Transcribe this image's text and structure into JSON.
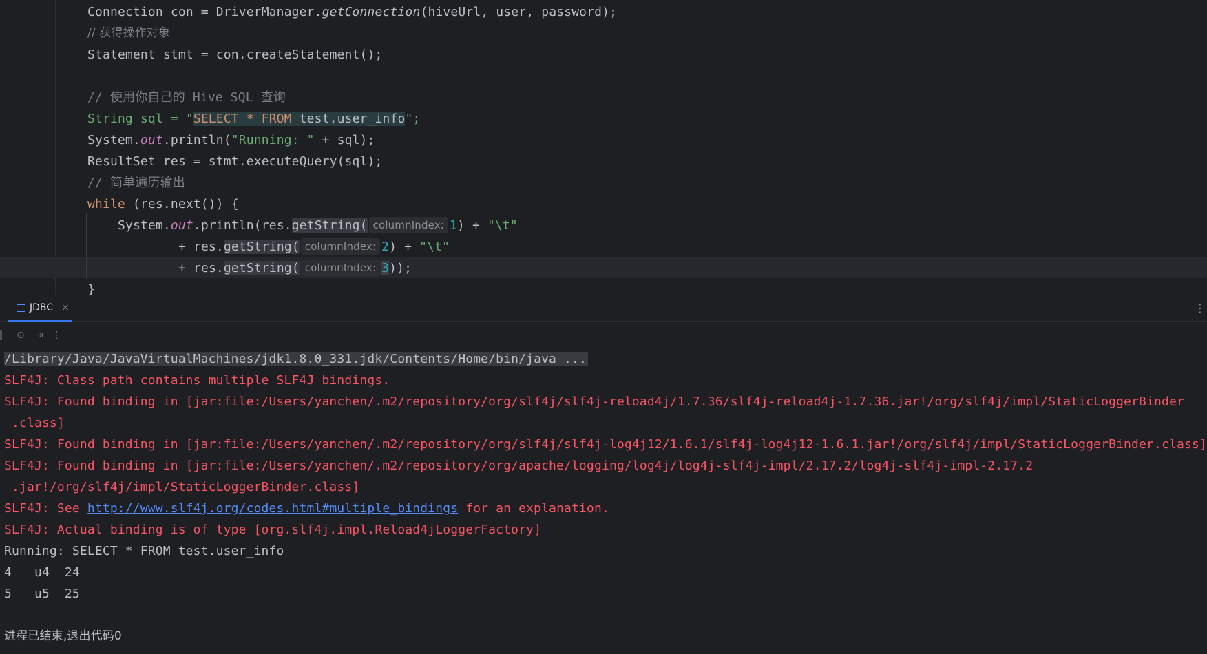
{
  "editor": {
    "lines": {
      "l1": {
        "a": "Connection con = DriverManager.",
        "m": "getConnection",
        "b": "(hiveUrl, user, password);"
      },
      "l2": "// 获得操作对象",
      "l3": "Statement stmt = con.createStatement();",
      "l5": "// 使用你自己的 Hive SQL 查询",
      "l6": {
        "a": "String sql = \"",
        "k1": "SELECT * FROM",
        "t": " test.user_info",
        "b": "\";"
      },
      "l7": {
        "a": "System.",
        "f": "out",
        "b": ".println(",
        "s": "\"Running: \"",
        "c": " + sql);"
      },
      "l8": "ResultSet res = stmt.executeQuery(sql);",
      "l9": "// 简单遍历输出",
      "l10": {
        "k": "while",
        "b": " (res.next()) {"
      },
      "l11": {
        "a": "System.",
        "f": "out",
        "b": ".println(res.",
        "m": "getString(",
        "h": "columnIndex:",
        "n": "1",
        "c": ") + ",
        "s": "\"\\t\""
      },
      "l12": {
        "a": "+ res.",
        "m": "getString(",
        "h": "columnIndex:",
        "n": "2",
        "c": ") + ",
        "s": "\"\\t\""
      },
      "l13": {
        "a": "+ res.",
        "m": "getString(",
        "h": "columnIndex:",
        "n": "3",
        "c": "));"
      },
      "l14": "}"
    }
  },
  "toolwindow": {
    "tab_label": "JDBC",
    "tab_close": "×",
    "more": "⋮"
  },
  "toolbar": {
    "camera": "⊙",
    "exit": "⇥",
    "more": "⋮"
  },
  "console": {
    "cmd": "/Library/Java/JavaVirtualMachines/jdk1.8.0_331.jdk/Contents/Home/bin/java ...",
    "e1": "SLF4J: Class path contains multiple SLF4J bindings.",
    "e2a": "SLF4J: Found binding in [jar:file:/Users/yanchen/.m2/repository/org/slf4j/slf4j-reload4j/1.7.36/slf4j-reload4j-1.7.36.jar!/org/slf4j/impl/StaticLoggerBinder",
    "e2b": " .class]",
    "e3": "SLF4J: Found binding in [jar:file:/Users/yanchen/.m2/repository/org/slf4j/slf4j-log4j12/1.6.1/slf4j-log4j12-1.6.1.jar!/org/slf4j/impl/StaticLoggerBinder.class]",
    "e4a": "SLF4J: Found binding in [jar:file:/Users/yanchen/.m2/repository/org/apache/logging/log4j/log4j-slf4j-impl/2.17.2/log4j-slf4j-impl-2.17.2",
    "e4b": " .jar!/org/slf4j/impl/StaticLoggerBinder.class]",
    "e5a": "SLF4J: See ",
    "e5link": "http://www.slf4j.org/codes.html#multiple_bindings",
    "e5b": " for an explanation.",
    "e6": "SLF4J: Actual binding is of type [org.slf4j.impl.Reload4jLoggerFactory]",
    "o1": "Running: SELECT * FROM test.user_info",
    "o2": "4   u4  24",
    "o3": "5   u5  25",
    "o4": "进程已结束,退出代码0"
  }
}
